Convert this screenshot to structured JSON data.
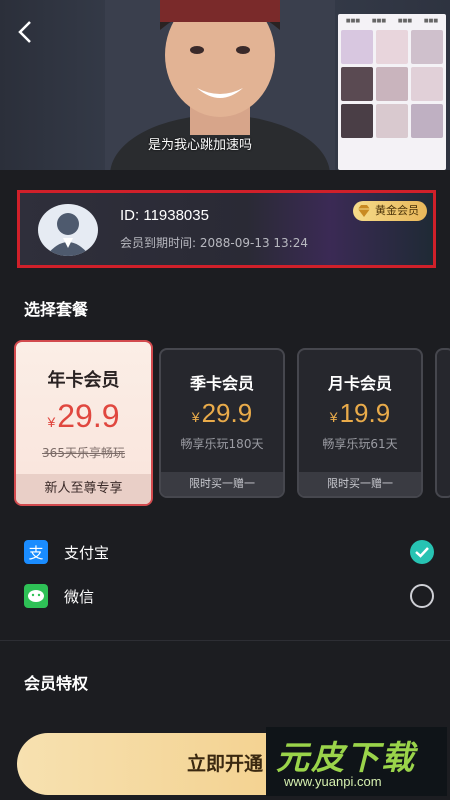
{
  "video": {
    "caption": "是为我心跳加速吗",
    "back_icon": "chevron-left-icon"
  },
  "member": {
    "id": "ID: 11938035",
    "expiry": "会员到期时间:  2088-09-13 13:24",
    "badge": "黄金会员"
  },
  "plans_section": {
    "title": "选择套餐",
    "plans": [
      {
        "name": "年卡会员",
        "currency": "¥",
        "price": "29.9",
        "desc": "365天乐享畅玩",
        "footer": "新人至尊专享",
        "selected": true
      },
      {
        "name": "季卡会员",
        "currency": "¥",
        "price": "29.9",
        "desc": "畅享乐玩180天",
        "footer": "限时买一赠一",
        "selected": false
      },
      {
        "name": "月卡会员",
        "currency": "¥",
        "price": "19.9",
        "desc": "畅享乐玩61天",
        "footer": "限时买一赠一",
        "selected": false
      }
    ]
  },
  "payment": {
    "methods": [
      {
        "label": "支付宝",
        "icon": "alipay-icon",
        "checked": true
      },
      {
        "label": "微信",
        "icon": "wechat-icon",
        "checked": false
      }
    ]
  },
  "privileges": {
    "title": "会员特权"
  },
  "action": {
    "label": "立即开通"
  },
  "watermark": {
    "title": "元皮下载",
    "url": "www.yuanpi.com"
  },
  "colors": {
    "accent_gold": "#f1c97e",
    "selected_red": "#d24a4e",
    "check_teal": "#27c3b3",
    "price_orange": "#e9ab4a"
  }
}
